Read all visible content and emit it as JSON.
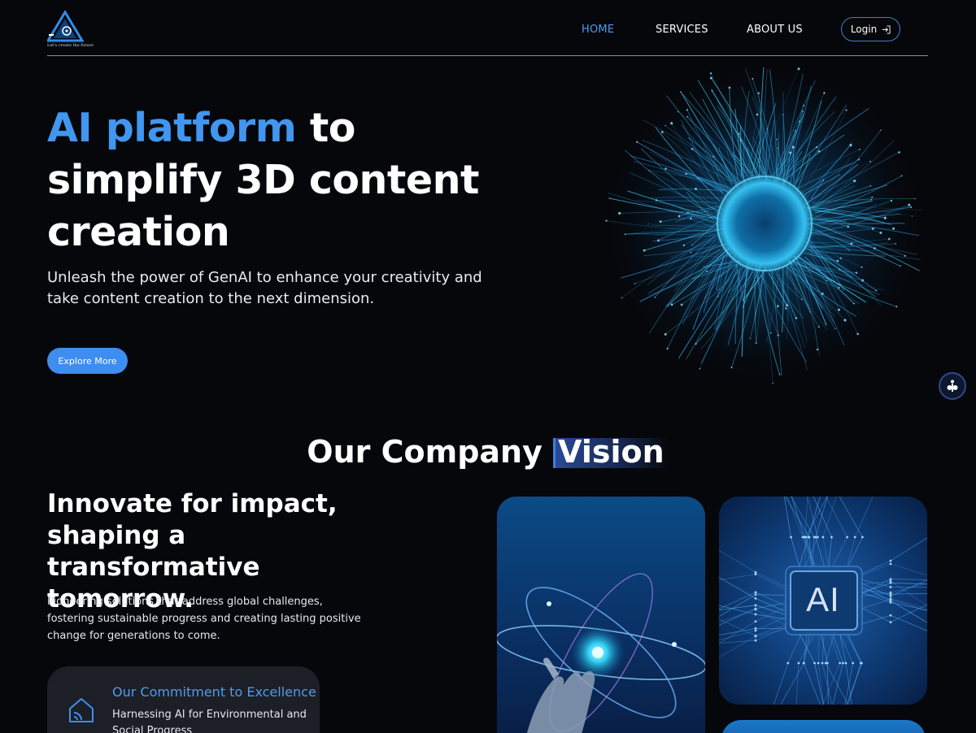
{
  "header": {
    "logo_tagline": "Let's create the future",
    "nav": [
      {
        "label": "HOME",
        "active": true
      },
      {
        "label": "SERVICES",
        "active": false
      },
      {
        "label": "ABOUT US",
        "active": false
      }
    ],
    "login_label": "Login"
  },
  "hero": {
    "title_accent": "AI platform",
    "title_rest": " to simplify 3D content creation",
    "subtitle": "Unleash the power of GenAI to enhance your creativity and take content creation to the next dimension.",
    "cta_label": "Explore More"
  },
  "vision": {
    "title_part1": "Our Company",
    "title_part2": "Vision",
    "heading": "Innovate for impact, shaping a transformative tomorrow.",
    "description": "Pioneering solutions that address global challenges, fostering sustainable progress and creating lasting positive change for generations to come.",
    "commitment": {
      "title": "Our Commitment to Excellence",
      "text": "Harnessing AI for Environmental and Social Progress"
    },
    "ai_card_label": "AI"
  },
  "colors": {
    "background": "#06070b",
    "accent": "#4196f0",
    "button": "#3d8ef0",
    "card": "#1d1f26"
  },
  "icons": {
    "login": "login-arrow-icon",
    "commitment": "home-signal-icon",
    "side_widget": "accessibility-icon"
  }
}
